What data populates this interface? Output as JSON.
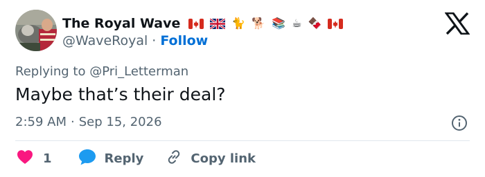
{
  "tweet": {
    "author": {
      "display_name": "The Royal Wave",
      "handle": "@WaveRoyal",
      "follow_label": "Follow",
      "name_emojis": [
        {
          "icon": "canada-flag-icon"
        },
        {
          "icon": "uk-flag-icon"
        },
        {
          "char": "🐈",
          "icon": "cat-icon"
        },
        {
          "char": "🐕",
          "icon": "dog-icon"
        },
        {
          "char": "📚",
          "icon": "books-icon"
        },
        {
          "char": "☕",
          "icon": "hot-beverage-icon"
        },
        {
          "char": "🍫",
          "icon": "chocolate-bar-icon"
        },
        {
          "icon": "canada-flag-icon"
        }
      ]
    },
    "separator": "·",
    "replying_to": "Replying to @Pri_Letterman",
    "text": "Maybe that’s their deal?",
    "time": "2:59 AM",
    "date": "Sep 15, 2026",
    "actions": {
      "like_count": "1",
      "reply_label": "Reply",
      "copy_link_label": "Copy link"
    }
  },
  "colors": {
    "text": "#0f1419",
    "secondary": "#536471",
    "follow": "#006fd6",
    "like": "#f91880",
    "reply": "#1d9bf0",
    "divider": "#e1e8ed"
  }
}
